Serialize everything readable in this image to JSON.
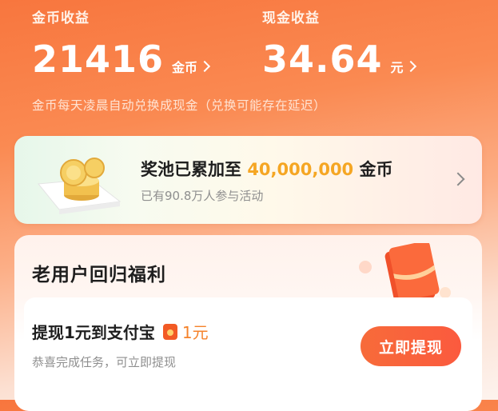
{
  "earnings": {
    "coins": {
      "label": "金币收益",
      "value": "21416",
      "unit": "金币"
    },
    "cash": {
      "label": "现金收益",
      "value": "34.64",
      "unit": "元"
    },
    "note": "金币每天凌晨自动兑换成现金（兑换可能存在延迟）"
  },
  "pool": {
    "title_prefix": "奖池已累加至",
    "amount": "40,000,000",
    "title_suffix": "金币",
    "subtitle": "已有90.8万人参与活动"
  },
  "return_benefit": {
    "title": "老用户回归福利",
    "task": {
      "title": "提现1元到支付宝",
      "amount": "1元",
      "subtitle": "恭喜完成任务，可立即提现",
      "button": "立即提现"
    }
  },
  "colors": {
    "accent": "#f76b3a",
    "highlight": "#f5a623"
  },
  "icons": [
    "chevron-right-icon",
    "coins-stack-icon",
    "red-packet-icon",
    "red-envelope-illustration"
  ]
}
